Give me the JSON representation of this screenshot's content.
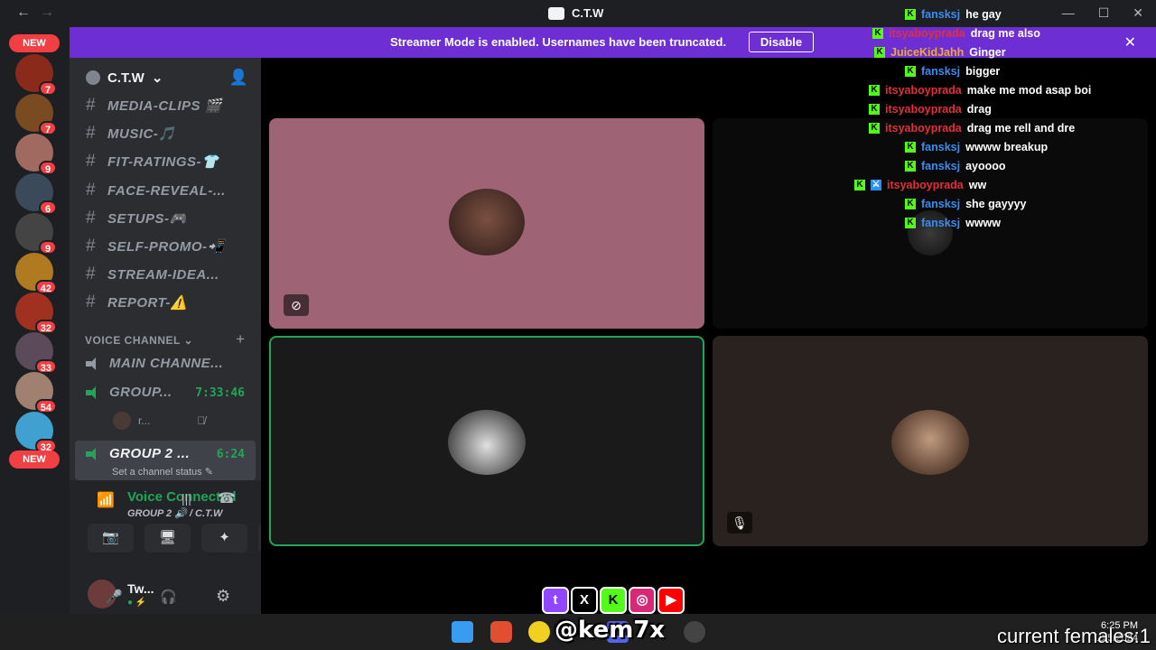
{
  "window": {
    "title": "C.T.W",
    "back_glyph": "←",
    "forward_glyph": "→",
    "controls": [
      "—",
      "☐",
      "✕"
    ]
  },
  "banner": {
    "text": "Streamer Mode is enabled. Usernames have been truncated.",
    "button": "Disable",
    "close": "✕"
  },
  "rail": {
    "new_top": "NEW",
    "new_bottom": "NEW",
    "servers": [
      {
        "badge": "7",
        "color": "#8a2a1a"
      },
      {
        "badge": "7",
        "color": "#7a4a20"
      },
      {
        "badge": "9",
        "color": "#a06a60"
      },
      {
        "badge": "6",
        "color": "#3a4a5a"
      },
      {
        "badge": "9",
        "color": "#444444"
      },
      {
        "badge": "42",
        "color": "#b07a20"
      },
      {
        "badge": "32",
        "color": "#a03020"
      },
      {
        "badge": "33",
        "color": "#5a4a5a"
      },
      {
        "badge": "54",
        "color": "#a08070"
      },
      {
        "badge": "32",
        "color": "#40a0d0"
      }
    ]
  },
  "sidebar": {
    "server_name": "C.T.W",
    "channels": [
      {
        "label": "MEDIA-CLIPS 🎬"
      },
      {
        "label": "MUSIC-🎵"
      },
      {
        "label": "FIT-RATINGS-👕"
      },
      {
        "label": "FACE-REVEAL-..."
      },
      {
        "label": "SETUPS-🎮"
      },
      {
        "label": "SELF-PROMO-📲"
      },
      {
        "label": "STREAM-IDEA..."
      },
      {
        "label": "REPORT-⚠️"
      }
    ],
    "category": "VOICE CHANNEL ⌄",
    "voice_channels": [
      {
        "label": "MAIN CHANNE...",
        "timer": ""
      },
      {
        "label": "GROUP...",
        "timer": "7:33:46"
      },
      {
        "label": "GROUP 2 ...",
        "timer": "6:24"
      }
    ],
    "group_member": "r...",
    "channel_status": "Set a channel status ✎"
  },
  "voice_panel": {
    "title": "Voice Connected",
    "subtitle": "GROUP 2 🔊 / C.T.W",
    "buttons": [
      "📷",
      "🖥",
      "✦",
      "✧"
    ],
    "user_name": "Tw...",
    "user_status": "● ⚡",
    "mute": "🎤",
    "deafen": "🎧",
    "settings": "⚙"
  },
  "chat": [
    {
      "user": "fansksj",
      "text": "he gay",
      "color": "#3a8cf0",
      "indent": 62,
      "badges": [
        "K"
      ]
    },
    {
      "user": "itsyaboyprada",
      "text": "drag me also",
      "color": "#e0303a",
      "indent": 26,
      "badges": [
        "K"
      ]
    },
    {
      "user": "JuiceKidJahh",
      "text": "Ginger",
      "color": "#f0a830",
      "indent": 28,
      "badges": [
        "K"
      ]
    },
    {
      "user": "fansksj",
      "text": "bigger",
      "color": "#3a8cf0",
      "indent": 62,
      "badges": [
        "K"
      ]
    },
    {
      "user": "itsyaboyprada",
      "text": "make me mod asap boi",
      "color": "#e0303a",
      "indent": 22,
      "badges": [
        "K"
      ]
    },
    {
      "user": "itsyaboyprada",
      "text": "drag",
      "color": "#e0303a",
      "indent": 22,
      "badges": [
        "K"
      ]
    },
    {
      "user": "itsyaboyprada",
      "text": "drag me rell and dre",
      "color": "#e0303a",
      "indent": 22,
      "badges": [
        "K"
      ]
    },
    {
      "user": "fansksj",
      "text": "wwww breakup",
      "color": "#3a8cf0",
      "indent": 62,
      "badges": [
        "K"
      ]
    },
    {
      "user": "fansksj",
      "text": "ayoooo",
      "color": "#3a8cf0",
      "indent": 62,
      "badges": [
        "K"
      ]
    },
    {
      "user": "itsyaboyprada",
      "text": "ww",
      "color": "#e0303a",
      "indent": 6,
      "badges": [
        "K",
        "M"
      ]
    },
    {
      "user": "fansksj",
      "text": "she gayyyy",
      "color": "#3a8cf0",
      "indent": 62,
      "badges": [
        "K"
      ]
    },
    {
      "user": "fansksj",
      "text": "wwww",
      "color": "#3a8cf0",
      "indent": 62,
      "badges": [
        "K"
      ]
    }
  ],
  "overlay": {
    "handle": "@kem7x",
    "social": [
      "t",
      "X",
      "K",
      "◎",
      "▶"
    ],
    "females": "current females:1"
  },
  "taskbar": {
    "clock_time": "6:25 PM",
    "clock_date": "10/5/2024"
  }
}
